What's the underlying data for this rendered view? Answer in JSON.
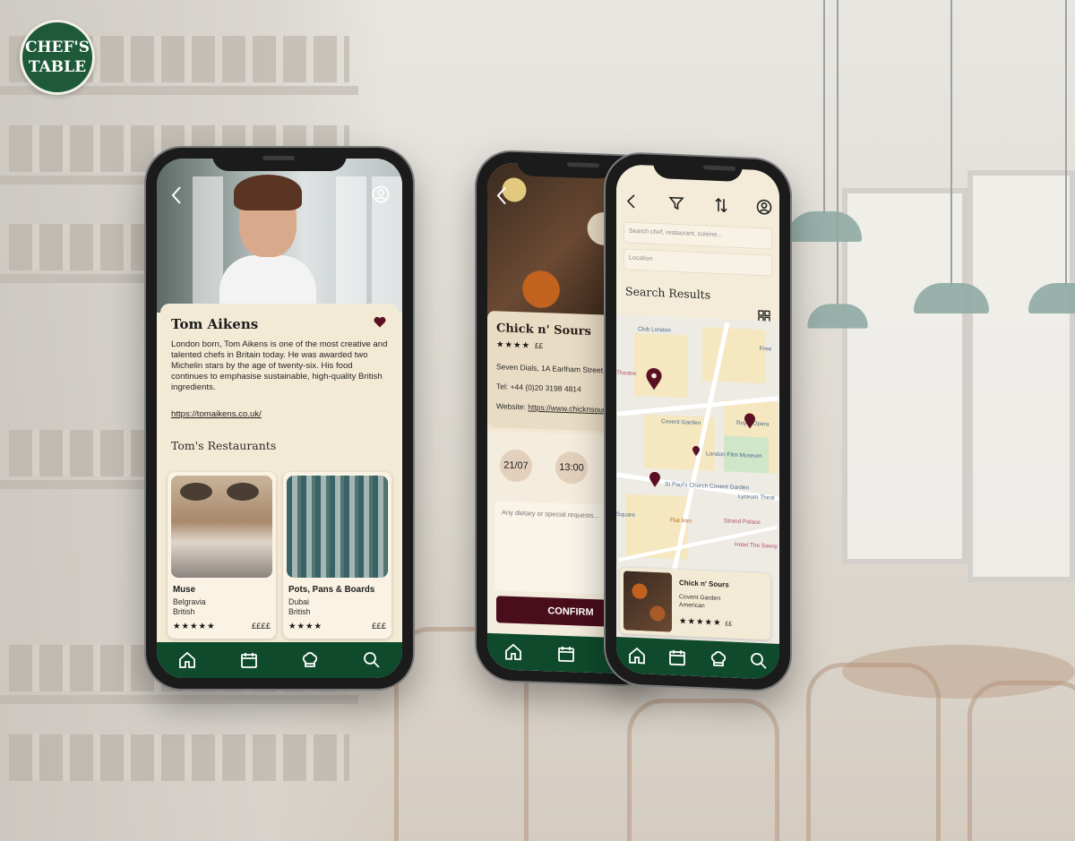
{
  "logo": {
    "line1": "CHEF'S",
    "line2": "TABLE"
  },
  "chef_profile": {
    "name": "Tom Aikens",
    "bio": "London born, Tom Aikens is one of the most creative and talented chefs in Britain today. He was awarded two Michelin stars by the age of twenty-six. His food continues to emphasise sustainable, high-quality British ingredients.",
    "website": "https://tomaikens.co.uk/",
    "restaurants_heading": "Tom's Restaurants",
    "restaurants": [
      {
        "name": "Muse",
        "area": "Belgravia",
        "cuisine": "British",
        "rating": "★★★★★",
        "price": "££££"
      },
      {
        "name": "Pots, Pans & Boards",
        "area": "Dubai",
        "cuisine": "British",
        "rating": "★★★★",
        "price": "£££"
      }
    ]
  },
  "booking": {
    "restaurant_name": "Chick n' Sours",
    "rating": "★★★★",
    "price": "££",
    "address": "Seven Dials, 1A Earlham Street, Lo",
    "phone": "Tel: +44 (0)20 3198 4814",
    "website_label": "Website: ",
    "website": "https://www.chicknsours",
    "date": "21/07",
    "time": "13:00",
    "request_placeholder": "Any dietary or special requests...",
    "confirm_label": "CONFIRM"
  },
  "search": {
    "query_placeholder": "Search chef, restaurant, cuisine...",
    "location_placeholder": "Location",
    "results_title": "Search Results",
    "map_labels": [
      "Club London",
      "Theatre",
      "Covent Garden",
      "Royal Opera",
      "London Film Museum",
      "St Paul's Church Covent Garden",
      "Lyceum Theat",
      "Square",
      "Flat Iron",
      "Strand Palace",
      "Hotel The Savoy",
      "Free"
    ],
    "result": {
      "name": "Chick n' Sours",
      "area": "Covent Garden",
      "cuisine": "American",
      "rating": "★★★★★",
      "price": "££"
    }
  },
  "colors": {
    "brand_green": "#0f4a2c",
    "accent_burgundy": "#4a0d1c",
    "card_cream": "#f3ead5"
  }
}
